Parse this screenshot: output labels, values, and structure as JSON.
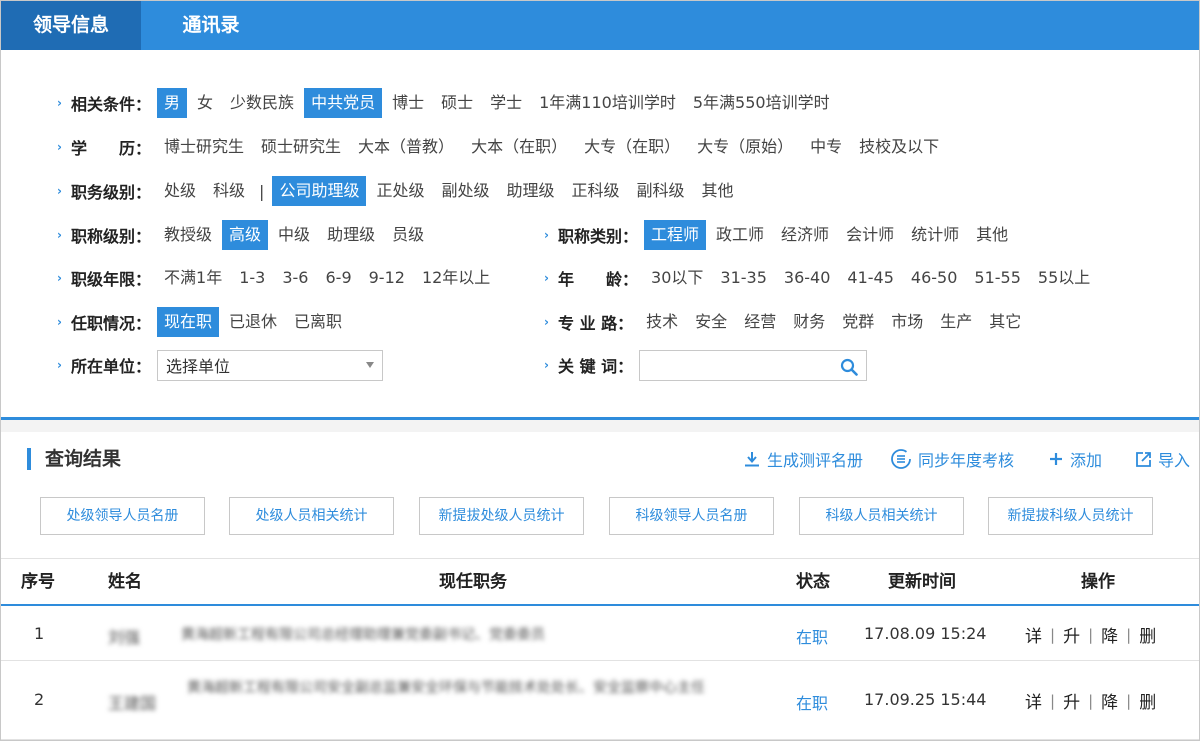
{
  "tabs": [
    {
      "label": "领导信息",
      "active": true
    },
    {
      "label": "通讯录",
      "active": false
    }
  ],
  "filters": {
    "conditions": {
      "label": "相关条件：",
      "options": [
        {
          "text": "男",
          "selected": true
        },
        {
          "text": "女",
          "selected": false
        },
        {
          "text": "少数民族",
          "selected": false
        },
        {
          "text": "中共党员",
          "selected": true
        },
        {
          "text": "博士",
          "selected": false
        },
        {
          "text": "硕士",
          "selected": false
        },
        {
          "text": "学士",
          "selected": false
        },
        {
          "text": "1年满110培训学时",
          "selected": false
        },
        {
          "text": "5年满550培训学时",
          "selected": false
        }
      ]
    },
    "education": {
      "label": "学　　历：",
      "options": [
        {
          "text": "博士研究生",
          "selected": false
        },
        {
          "text": "硕士研究生",
          "selected": false
        },
        {
          "text": "大本（普教）",
          "selected": false
        },
        {
          "text": "大本（在职）",
          "selected": false
        },
        {
          "text": "大专（在职）",
          "selected": false
        },
        {
          "text": "大专（原始）",
          "selected": false
        },
        {
          "text": "中专",
          "selected": false
        },
        {
          "text": "技校及以下",
          "selected": false
        }
      ]
    },
    "duty_level": {
      "label": "职务级别：",
      "options_a": [
        {
          "text": "处级",
          "selected": false
        },
        {
          "text": "科级",
          "selected": false
        }
      ],
      "separator": "|",
      "options_b": [
        {
          "text": "公司助理级",
          "selected": true
        },
        {
          "text": "正处级",
          "selected": false
        },
        {
          "text": "副处级",
          "selected": false
        },
        {
          "text": "助理级",
          "selected": false
        },
        {
          "text": "正科级",
          "selected": false
        },
        {
          "text": "副科级",
          "selected": false
        },
        {
          "text": "其他",
          "selected": false
        }
      ]
    },
    "title_level": {
      "label": "职称级别：",
      "options": [
        {
          "text": "教授级",
          "selected": false
        },
        {
          "text": "高级",
          "selected": true
        },
        {
          "text": "中级",
          "selected": false
        },
        {
          "text": "助理级",
          "selected": false
        },
        {
          "text": "员级",
          "selected": false
        }
      ]
    },
    "title_category": {
      "label": "职称类别：",
      "options": [
        {
          "text": "工程师",
          "selected": true
        },
        {
          "text": "政工师",
          "selected": false
        },
        {
          "text": "经济师",
          "selected": false
        },
        {
          "text": "会计师",
          "selected": false
        },
        {
          "text": "统计师",
          "selected": false
        },
        {
          "text": "其他",
          "selected": false
        }
      ]
    },
    "rank_years": {
      "label": "职级年限：",
      "options": [
        {
          "text": "不满1年",
          "selected": false
        },
        {
          "text": "1-3",
          "selected": false
        },
        {
          "text": "3-6",
          "selected": false
        },
        {
          "text": "6-9",
          "selected": false
        },
        {
          "text": "9-12",
          "selected": false
        },
        {
          "text": "12年以上",
          "selected": false
        }
      ]
    },
    "age": {
      "label": "年　　龄：",
      "options": [
        {
          "text": "30以下",
          "selected": false
        },
        {
          "text": "31-35",
          "selected": false
        },
        {
          "text": "36-40",
          "selected": false
        },
        {
          "text": "41-45",
          "selected": false
        },
        {
          "text": "46-50",
          "selected": false
        },
        {
          "text": "51-55",
          "selected": false
        },
        {
          "text": "55以上",
          "selected": false
        }
      ]
    },
    "tenure": {
      "label": "任职情况：",
      "options": [
        {
          "text": "现在职",
          "selected": true
        },
        {
          "text": "已退休",
          "selected": false
        },
        {
          "text": "已离职",
          "selected": false
        }
      ]
    },
    "specialty": {
      "label": "专 业 路：",
      "options": [
        {
          "text": "技术",
          "selected": false
        },
        {
          "text": "安全",
          "selected": false
        },
        {
          "text": "经营",
          "selected": false
        },
        {
          "text": "财务",
          "selected": false
        },
        {
          "text": "党群",
          "selected": false
        },
        {
          "text": "市场",
          "selected": false
        },
        {
          "text": "生产",
          "selected": false
        },
        {
          "text": "其它",
          "selected": false
        }
      ]
    },
    "unit": {
      "label": "所在单位：",
      "value": "选择单位"
    },
    "keyword": {
      "label": "关 键 词：",
      "value": "",
      "placeholder": ""
    }
  },
  "results": {
    "title": "查询结果",
    "actions": [
      {
        "label": "生成测评名册",
        "icon": "download-icon"
      },
      {
        "label": "同步年度考核",
        "icon": "sync-list-icon"
      },
      {
        "label": "添加",
        "icon": "plus-icon"
      },
      {
        "label": "导入",
        "icon": "import-icon"
      }
    ],
    "buttons": [
      "处级领导人员名册",
      "处级人员相关统计",
      "新提拔处级人员统计",
      "科级领导人员名册",
      "科级人员相关统计",
      "新提拔科级人员统计"
    ]
  },
  "table": {
    "headers": [
      "序号",
      "姓名",
      "现任职务",
      "状态",
      "更新时间",
      "操作"
    ],
    "rows": [
      {
        "index": "1",
        "name": "刘强",
        "position": "黄海超新工程有限公司总经理助理兼党委副书记、党委委员",
        "status": "在职",
        "time": "17.08.09 15:24"
      },
      {
        "index": "2",
        "name": "王建国",
        "position": "黄海超新工程有限公司安全副总监兼安全环保与节能技术处处长、安全监察中心主任",
        "status": "在职",
        "time": "17.09.25 15:44"
      }
    ],
    "ops": [
      "详",
      "升",
      "降",
      "删"
    ]
  }
}
